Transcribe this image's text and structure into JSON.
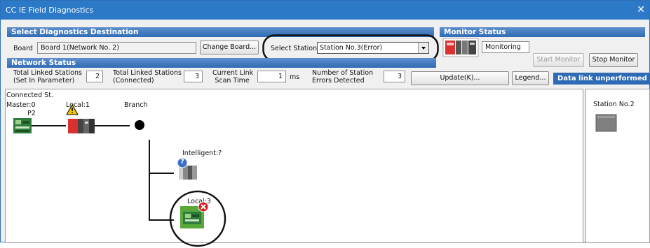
{
  "window": {
    "title": "CC IE Field Diagnostics",
    "close_glyph": "✕"
  },
  "destination": {
    "header": "Select Diagnostics Destination",
    "board_label": "Board",
    "board_value": "Board 1(Network No. 2)",
    "change_board_button": "Change Board...",
    "select_station_label": "Select Station",
    "select_station_value": "Station No.3(Error)"
  },
  "monitor": {
    "header": "Monitor Status",
    "status_text": "Monitoring",
    "start_button": "Start Monitor",
    "stop_button": "Stop Monitor"
  },
  "network_status": {
    "header": "Network Status",
    "total_linked_param_label_1": "Total Linked Stations",
    "total_linked_param_label_2": "(Set In Parameter)",
    "total_linked_param_value": "2",
    "total_linked_connected_label_1": "Total Linked Stations",
    "total_linked_connected_label_2": "(Connected)",
    "total_linked_connected_value": "3",
    "scan_time_label_1": "Current Link",
    "scan_time_label_2": "Scan Time",
    "scan_time_value": "1",
    "scan_time_unit": "ms",
    "errors_label_1": "Number of Station",
    "errors_label_2": "Errors Detected",
    "errors_value": "3",
    "update_button": "Update(K)...",
    "legend_button": "Legend...",
    "data_link_banner": "Data link unperformed"
  },
  "topology": {
    "connected_label": "Connected St.",
    "master_label": "Master:0",
    "master_port": "P2",
    "local1_label": "Local:1",
    "branch_label": "Branch",
    "intelligent_label": "Intelligent:?",
    "local3_label": "Local:3"
  },
  "side_panel": {
    "station_label": "Station No.2"
  },
  "colors": {
    "title": "#2b79c7",
    "section": "#2f6bb5",
    "warning": "#f5c800",
    "error": "#d62020",
    "station_green": "#5aa83a"
  }
}
